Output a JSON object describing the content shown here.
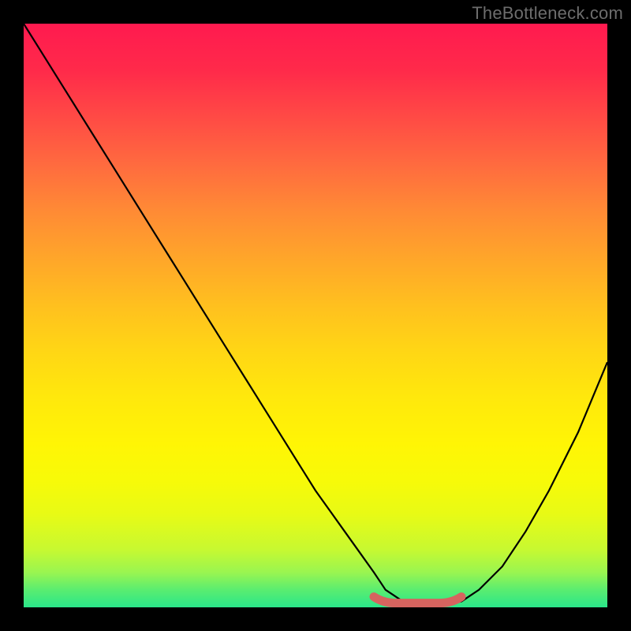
{
  "watermark": "TheBottleneck.com",
  "chart_data": {
    "type": "line",
    "title": "",
    "xlabel": "",
    "ylabel": "",
    "xlim": [
      0,
      100
    ],
    "ylim": [
      0,
      100
    ],
    "grid": false,
    "series": [
      {
        "name": "bottleneck-curve",
        "x": [
          0,
          5,
          10,
          15,
          20,
          25,
          30,
          35,
          40,
          45,
          50,
          55,
          60,
          62,
          65,
          68,
          72,
          75,
          78,
          82,
          86,
          90,
          95,
          100
        ],
        "y": [
          100,
          92,
          84,
          76,
          68,
          60,
          52,
          44,
          36,
          28,
          20,
          13,
          6,
          3,
          1,
          0.5,
          0.5,
          1,
          3,
          7,
          13,
          20,
          30,
          42
        ]
      }
    ],
    "annotations": [
      {
        "name": "min-region",
        "x_start": 60,
        "x_end": 75,
        "y": 1,
        "color": "#d6645f"
      }
    ],
    "background": {
      "type": "vertical-gradient",
      "stops": [
        {
          "pos": 0,
          "color": "#ff1a4f"
        },
        {
          "pos": 50,
          "color": "#ffd615"
        },
        {
          "pos": 100,
          "color": "#2ae68a"
        }
      ]
    }
  }
}
